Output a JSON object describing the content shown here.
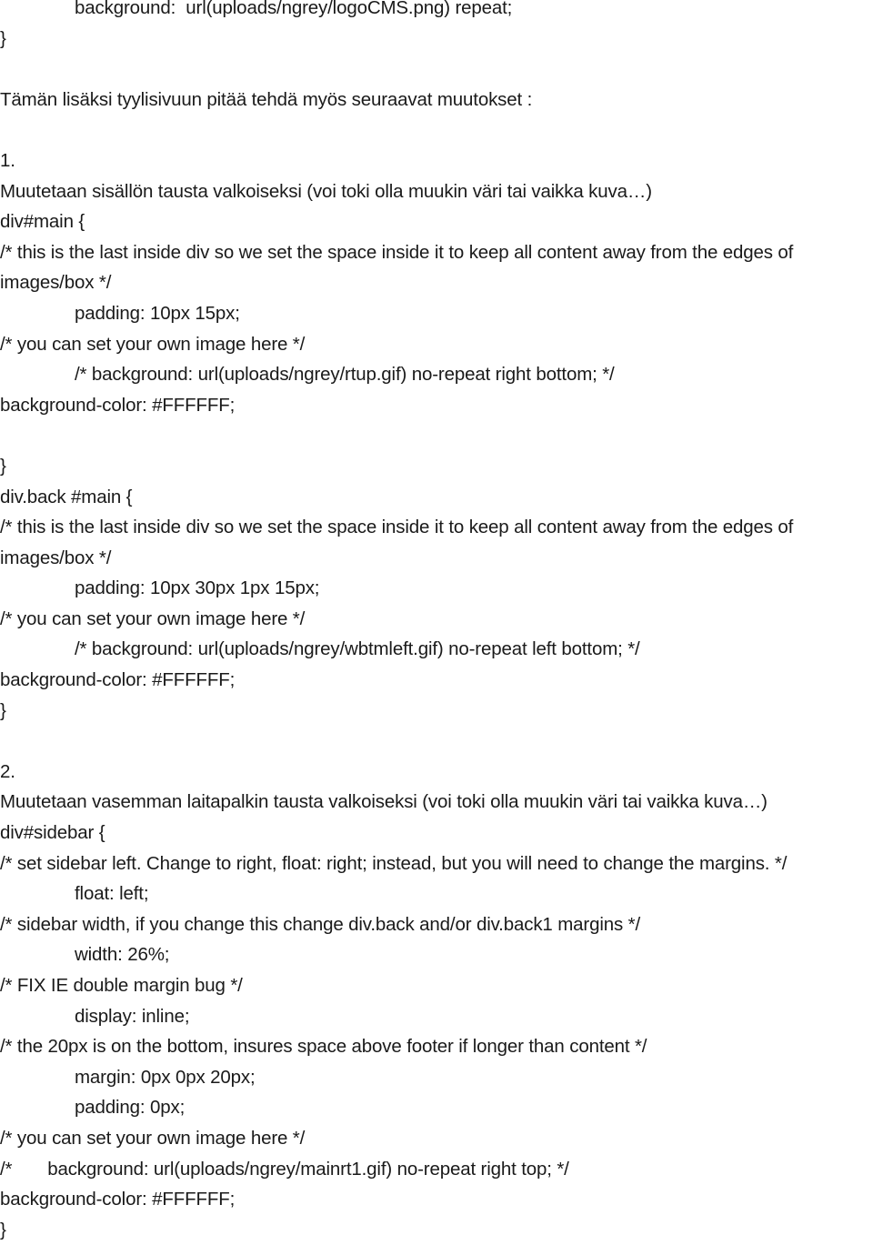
{
  "document": {
    "language": "fi",
    "text_color": "#1a1a1a",
    "background_color": "#ffffff",
    "lines": [
      {
        "indent": 1,
        "text": "background:  url(uploads/ngrey/logoCMS.png) repeat;"
      },
      {
        "indent": 0,
        "text": "}"
      },
      {
        "indent": 0,
        "text": ""
      },
      {
        "indent": 0,
        "text": "Tämän lisäksi tyylisivuun pitää tehdä myös seuraavat muutokset :"
      },
      {
        "indent": 0,
        "text": ""
      },
      {
        "indent": 0,
        "text": "1."
      },
      {
        "indent": 0,
        "text": "Muutetaan sisällön tausta valkoiseksi (voi toki olla muukin väri tai vaikka kuva…)"
      },
      {
        "indent": 0,
        "text": "div#main {"
      },
      {
        "indent": 0,
        "text": "/* this is the last inside div so we set the space inside it to keep all content away from the edges of"
      },
      {
        "indent": 0,
        "text": "images/box */"
      },
      {
        "indent": 1,
        "text": "padding: 10px 15px;"
      },
      {
        "indent": 0,
        "text": "/* you can set your own image here */"
      },
      {
        "indent": 1,
        "text": "/* background: url(uploads/ngrey/rtup.gif) no-repeat right bottom; */"
      },
      {
        "indent": 0,
        "text": "background-color: #FFFFFF;"
      },
      {
        "indent": 0,
        "text": ""
      },
      {
        "indent": 0,
        "text": "}"
      },
      {
        "indent": 0,
        "text": "div.back #main {"
      },
      {
        "indent": 0,
        "text": "/* this is the last inside div so we set the space inside it to keep all content away from the edges of"
      },
      {
        "indent": 0,
        "text": "images/box */"
      },
      {
        "indent": 1,
        "text": "padding: 10px 30px 1px 15px;"
      },
      {
        "indent": 0,
        "text": "/* you can set your own image here */"
      },
      {
        "indent": 1,
        "text": "/* background: url(uploads/ngrey/wbtmleft.gif) no-repeat left bottom; */"
      },
      {
        "indent": 0,
        "text": "background-color: #FFFFFF;"
      },
      {
        "indent": 0,
        "text": "}"
      },
      {
        "indent": 0,
        "text": ""
      },
      {
        "indent": 0,
        "text": "2."
      },
      {
        "indent": 0,
        "text": "Muutetaan vasemman laitapalkin tausta valkoiseksi (voi toki olla muukin väri tai vaikka kuva…)"
      },
      {
        "indent": 0,
        "text": "div#sidebar {"
      },
      {
        "indent": 0,
        "text": "/* set sidebar left. Change to right, float: right; instead, but you will need to change the margins. */"
      },
      {
        "indent": 1,
        "text": "float: left;"
      },
      {
        "indent": 0,
        "text": "/* sidebar width, if you change this change div.back and/or div.back1 margins */"
      },
      {
        "indent": 1,
        "text": "width: 26%;"
      },
      {
        "indent": 0,
        "text": "/* FIX IE double margin bug */"
      },
      {
        "indent": 1,
        "text": "display: inline;"
      },
      {
        "indent": 0,
        "text": "/* the 20px is on the bottom, insures space above footer if longer than content */"
      },
      {
        "indent": 1,
        "text": "margin: 0px 0px 20px;"
      },
      {
        "indent": 1,
        "text": "padding: 0px;"
      },
      {
        "indent": 0,
        "text": "/* you can set your own image here */"
      },
      {
        "indent": 0,
        "text": "/*       background: url(uploads/ngrey/mainrt1.gif) no-repeat right top; */"
      },
      {
        "indent": 0,
        "text": "background-color: #FFFFFF;"
      },
      {
        "indent": 0,
        "text": "}"
      }
    ]
  }
}
